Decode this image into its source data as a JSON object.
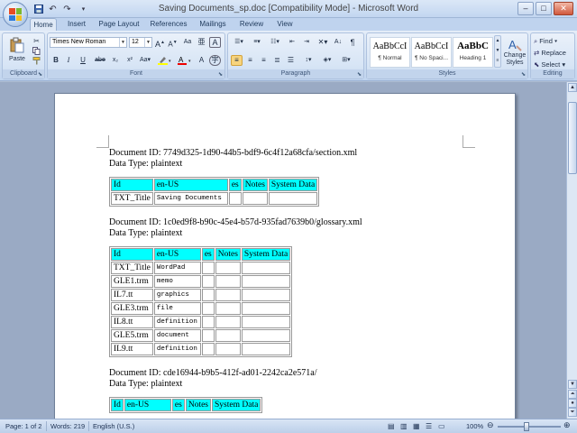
{
  "window": {
    "title": "Saving Documents_sp.doc [Compatibility Mode] - Microsoft Word",
    "minimize": "–",
    "maximize": "□",
    "close": "✕"
  },
  "quick_access": [
    {
      "name": "save-icon",
      "glyph": "💾"
    },
    {
      "name": "undo-icon",
      "glyph": "↶"
    },
    {
      "name": "redo-icon",
      "glyph": "↷"
    },
    {
      "name": "customize-icon",
      "glyph": "▾"
    }
  ],
  "tabs": [
    "Home",
    "Insert",
    "Page Layout",
    "References",
    "Mailings",
    "Review",
    "View"
  ],
  "ribbon": {
    "clipboard": {
      "label": "Clipboard",
      "paste": "Paste"
    },
    "font": {
      "label": "Font",
      "font_name": "Times New Roman",
      "font_size": "12",
      "bold": "B",
      "italic": "I",
      "underline": "U",
      "strike": "abe",
      "subscript": "x₂",
      "superscript": "x²",
      "clear": "Aa"
    },
    "paragraph": {
      "label": "Paragraph"
    },
    "styles": {
      "label": "Styles",
      "items": [
        {
          "preview": "AaBbCcI",
          "name": "¶ Normal"
        },
        {
          "preview": "AaBbCcI",
          "name": "¶ No Spaci..."
        },
        {
          "preview": "AaBbC",
          "name": "Heading 1"
        }
      ],
      "change_styles": "Change Styles"
    },
    "editing": {
      "label": "Editing",
      "find": "Find",
      "replace": "Replace",
      "select": "Select"
    }
  },
  "document": {
    "sections": [
      {
        "id_line": "Document ID: 7749d325-1d90-44b5-bdf9-6c4f12a68cfa/section.xml",
        "type_line": "Data Type: plaintext",
        "headers": [
          "Id",
          "en-US",
          "es",
          "Notes",
          "System Data"
        ],
        "rows": [
          [
            "TXT_Title",
            "Saving Documents",
            "",
            "",
            ""
          ]
        ]
      },
      {
        "id_line": "Document ID: 1c0ed9f8-b90c-45e4-b57d-935fad7639b0/glossary.xml",
        "type_line": "Data Type: plaintext",
        "headers": [
          "Id",
          "en-US",
          "es",
          "Notes",
          "System Data"
        ],
        "rows": [
          [
            "TXT_Title",
            "WordPad",
            "",
            "",
            ""
          ],
          [
            "GLE1.trm",
            "memo",
            "",
            "",
            ""
          ],
          [
            "IL7.tt",
            "graphics",
            "",
            "",
            ""
          ],
          [
            "GLE3.trm",
            "file",
            "",
            "",
            ""
          ],
          [
            "IL8.tt",
            "definition",
            "",
            "",
            ""
          ],
          [
            "GLE5.trm",
            "document",
            "",
            "",
            ""
          ],
          [
            "IL9.tt",
            "definition",
            "",
            "",
            ""
          ]
        ]
      },
      {
        "id_line": "Document ID: cde16944-b9b5-412f-ad01-2242ca2e571a/",
        "type_line": "Data Type: plaintext",
        "headers": [
          "Id",
          "en-US",
          "es",
          "Notes",
          "System Data"
        ],
        "rows": []
      }
    ]
  },
  "status": {
    "page": "Page: 1 of 2",
    "words": "Words: 219",
    "language": "English (U.S.)",
    "zoom": "100%"
  }
}
